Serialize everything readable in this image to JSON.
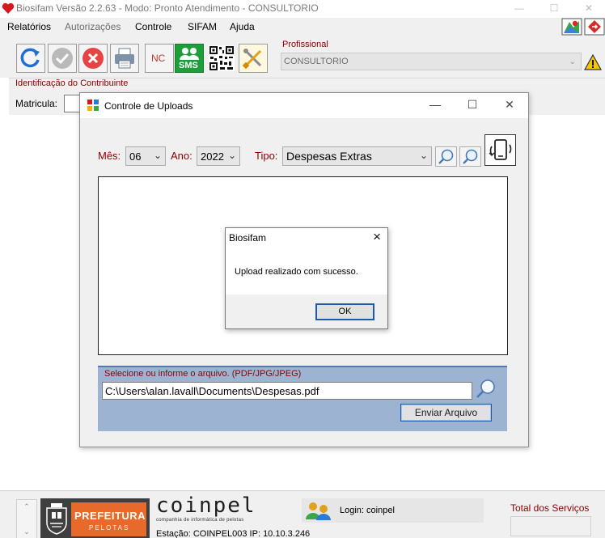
{
  "window": {
    "title": "Biosifam Versão 2.2.63 - Modo: Pronto Atendimento - CONSULTORIO",
    "controls": [
      "—",
      "☐",
      "✕"
    ]
  },
  "menu": {
    "items": [
      "Relatórios",
      "Autorizações",
      "Controle",
      "SIFAM",
      "Ajuda"
    ]
  },
  "toolbar": {
    "nc_label": "NC",
    "sms_label": "SMS"
  },
  "profissional": {
    "label": "Profissional",
    "value": "CONSULTORIO"
  },
  "identificacao": {
    "label": "Identificação do Contribuinte",
    "matricula_label": "Matricula:"
  },
  "uploads_dialog": {
    "title": "Controle de Uploads",
    "mes_label": "Mês:",
    "mes_value": "06",
    "ano_label": "Ano:",
    "ano_value": "2022",
    "tipo_label": "Tipo:",
    "tipo_value": "Despesas Extras",
    "select_label": "Selecione ou informe o arquivo. (PDF/JPG/JPEG)",
    "file_path": "C:\\Users\\alan.lavall\\Documents\\Despesas.pdf",
    "send_button": "Enviar Arquivo"
  },
  "message_box": {
    "title": "Biosifam",
    "text": "Upload realizado com sucesso.",
    "ok_label": "OK"
  },
  "status": {
    "prefeitura_name": "PREFEITURA",
    "prefeitura_city": "PELOTAS",
    "coinpel_logo": "coinpel",
    "coinpel_sub": "companhia de informática de pelotas",
    "estacao": "Estação: COINPEL003 IP: 10.10.3.246",
    "login": "Login: coinpel",
    "total_label": "Total dos Serviços"
  },
  "colors": {
    "accent": "#8b0000",
    "sms_green": "#1f9d3a",
    "prefeitura_orange": "#e86a2a",
    "selection_blue": "#9cb4d2"
  }
}
